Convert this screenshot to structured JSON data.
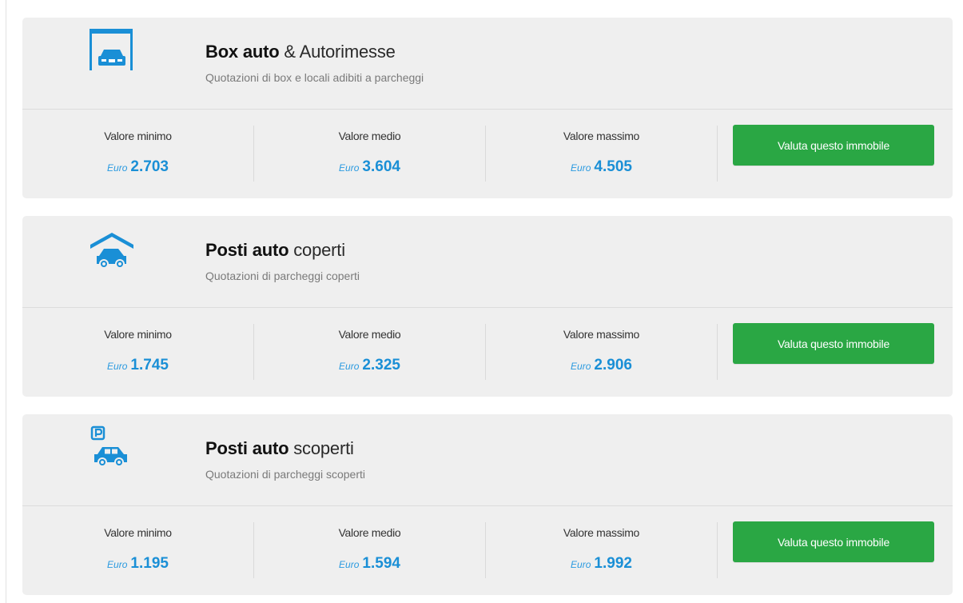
{
  "accent_color": "#1a8fd6",
  "button_color": "#2aa744",
  "cards": [
    {
      "icon": "garage-box-car-icon",
      "title_bold": "Box auto",
      "title_rest": " & Autorimesse",
      "subtitle": "Quotazioni di box e locali adibiti a parcheggi",
      "stats": [
        {
          "label": "Valore minimo",
          "currency": "Euro",
          "value": "2.703"
        },
        {
          "label": "Valore medio",
          "currency": "Euro",
          "value": "3.604"
        },
        {
          "label": "Valore massimo",
          "currency": "Euro",
          "value": "4.505"
        }
      ],
      "button_label": "Valuta questo immobile"
    },
    {
      "icon": "covered-parking-car-icon",
      "title_bold": "Posti auto",
      "title_rest": " coperti",
      "subtitle": "Quotazioni di parcheggi coperti",
      "stats": [
        {
          "label": "Valore minimo",
          "currency": "Euro",
          "value": "1.745"
        },
        {
          "label": "Valore medio",
          "currency": "Euro",
          "value": "2.325"
        },
        {
          "label": "Valore massimo",
          "currency": "Euro",
          "value": "2.906"
        }
      ],
      "button_label": "Valuta questo immobile"
    },
    {
      "icon": "open-parking-car-icon",
      "title_bold": "Posti auto",
      "title_rest": " scoperti",
      "subtitle": "Quotazioni di parcheggi scoperti",
      "stats": [
        {
          "label": "Valore minimo",
          "currency": "Euro",
          "value": "1.195"
        },
        {
          "label": "Valore medio",
          "currency": "Euro",
          "value": "1.594"
        },
        {
          "label": "Valore massimo",
          "currency": "Euro",
          "value": "1.992"
        }
      ],
      "button_label": "Valuta questo immobile"
    }
  ]
}
